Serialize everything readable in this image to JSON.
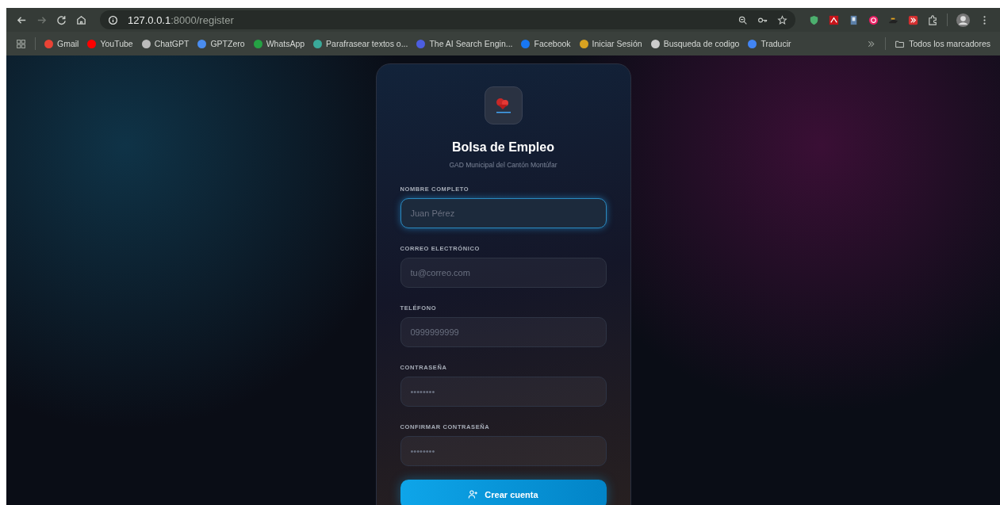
{
  "browser": {
    "url_host": "127.0.0.1",
    "url_path": ":8000/register",
    "bookmarks": [
      {
        "label": "Gmail",
        "color": "#ea4335"
      },
      {
        "label": "YouTube",
        "color": "#ff0000"
      },
      {
        "label": "ChatGPT",
        "color": "#bbbbbb"
      },
      {
        "label": "GPTZero",
        "color": "#4a8df0"
      },
      {
        "label": "WhatsApp",
        "color": "#25a244"
      },
      {
        "label": "Parafrasear textos o...",
        "color": "#3aa99a"
      },
      {
        "label": "The AI Search Engin...",
        "color": "#4c5ee0"
      },
      {
        "label": "Facebook",
        "color": "#1877f2"
      },
      {
        "label": "Iniciar Sesión",
        "color": "#d9a321"
      },
      {
        "label": "Busqueda de codigo",
        "color": "#cccccc"
      },
      {
        "label": "Traducir",
        "color": "#4285f4"
      }
    ],
    "all_bookmarks": "Todos los marcadores"
  },
  "card": {
    "title": "Bolsa de Empleo",
    "subtitle": "GAD Municipal del Cantón Montúfar",
    "fields": [
      {
        "label": "NOMBRE COMPLETO",
        "placeholder": "Juan Pérez",
        "focused": true
      },
      {
        "label": "CORREO ELECTRÓNICO",
        "placeholder": "tu@correo.com",
        "focused": false
      },
      {
        "label": "TELÉFONO",
        "placeholder": "0999999999",
        "focused": false
      },
      {
        "label": "CONTRASEÑA",
        "placeholder": "••••••••",
        "focused": false
      },
      {
        "label": "CONFIRMAR CONTRASEÑA",
        "placeholder": "••••••••",
        "focused": false
      }
    ],
    "submit": "Crear cuenta"
  }
}
